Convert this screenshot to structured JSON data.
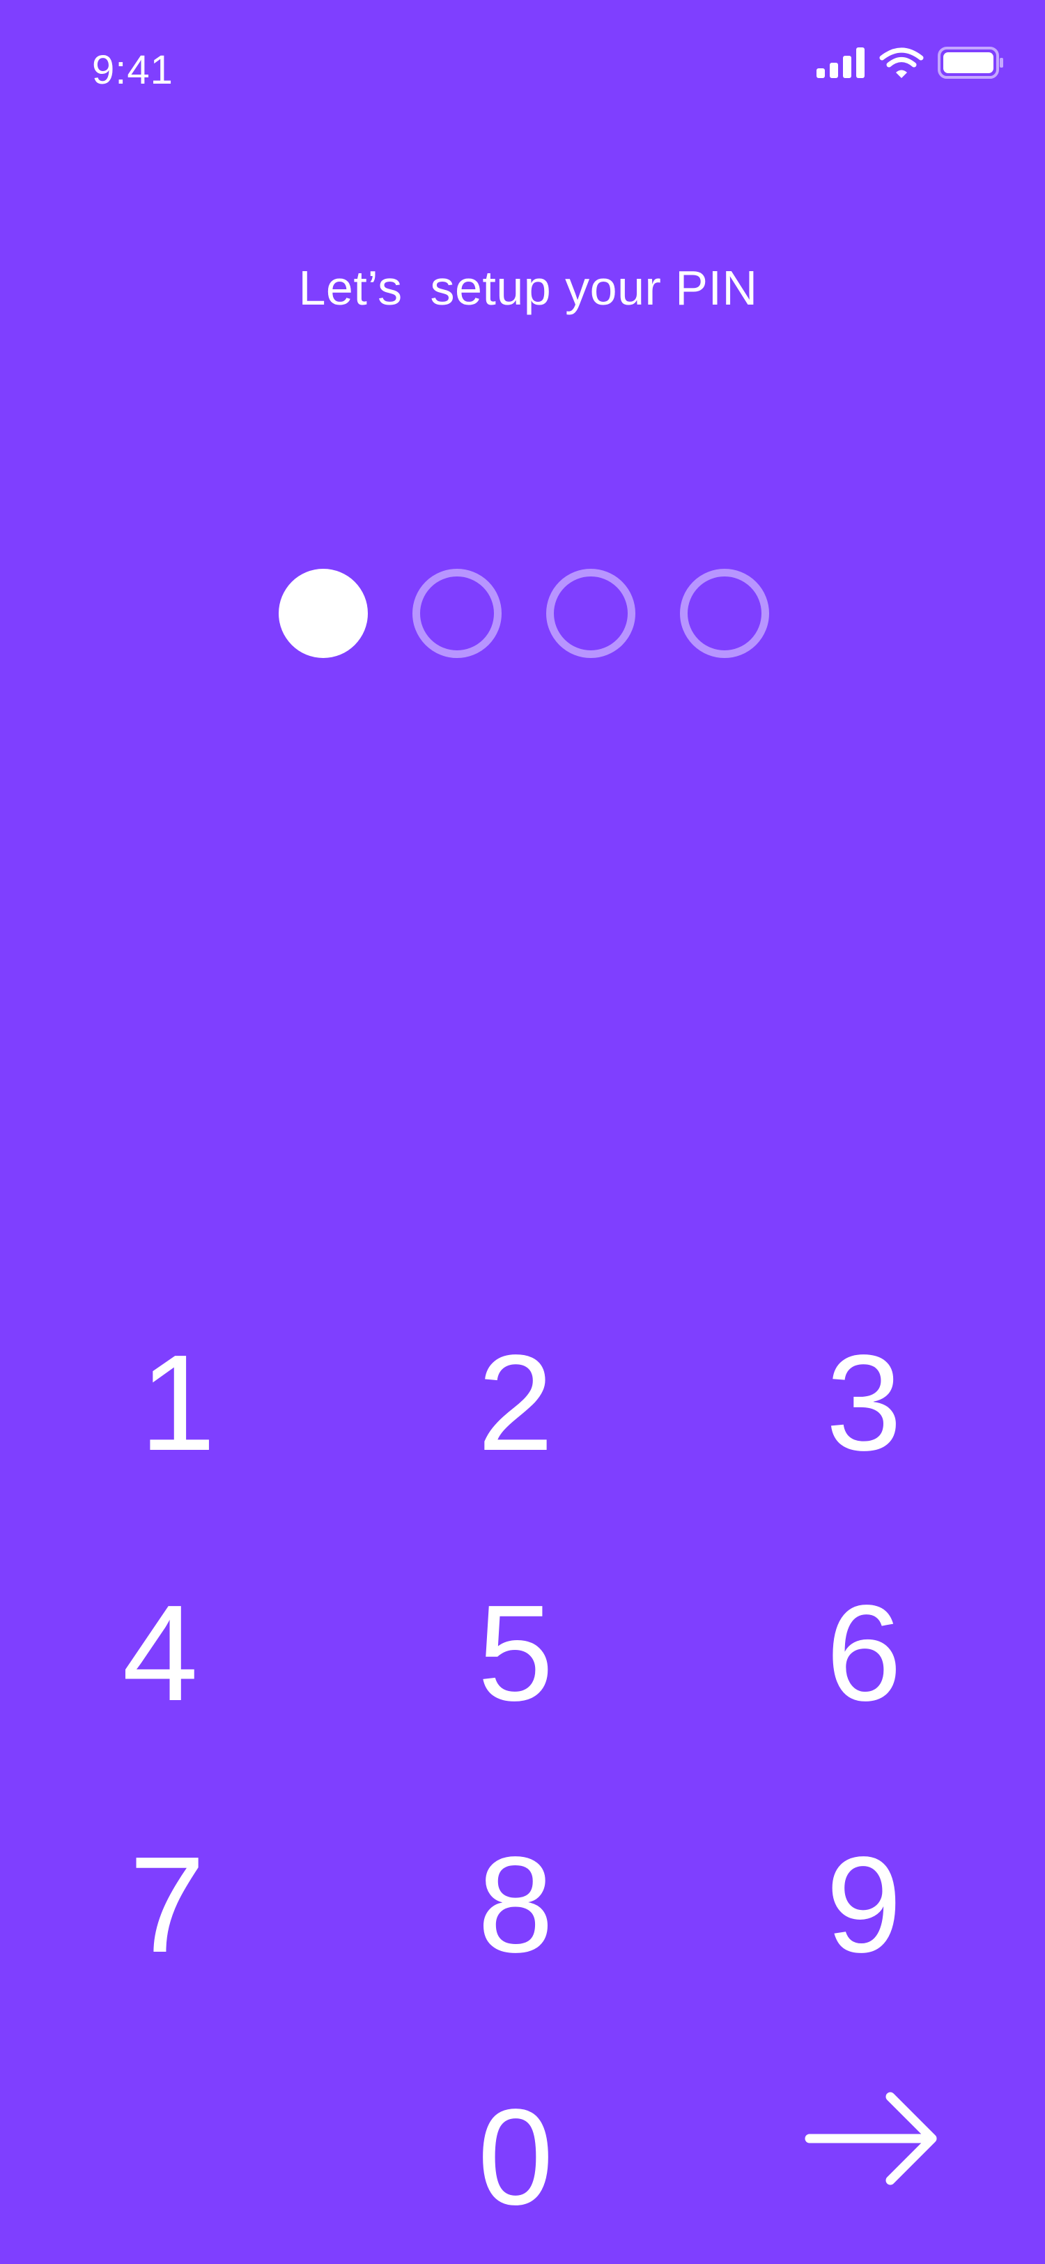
{
  "status_bar": {
    "time": "9:41",
    "icons": [
      "signal-icon",
      "wifi-icon",
      "battery-icon"
    ]
  },
  "title": "Let’s  setup your PIN",
  "pin": {
    "length": 4,
    "entered_count": 1
  },
  "keypad": {
    "k1": "1",
    "k2": "2",
    "k3": "3",
    "k4": "4",
    "k5": "5",
    "k6": "6",
    "k7": "7",
    "k8": "8",
    "k9": "9",
    "k0": "0",
    "next_icon": "arrow-right-icon"
  },
  "colors": {
    "background": "#7F3FFF",
    "foreground": "#FFFFFF",
    "empty_dot_ring": "rgba(255,255,255,0.45)"
  }
}
